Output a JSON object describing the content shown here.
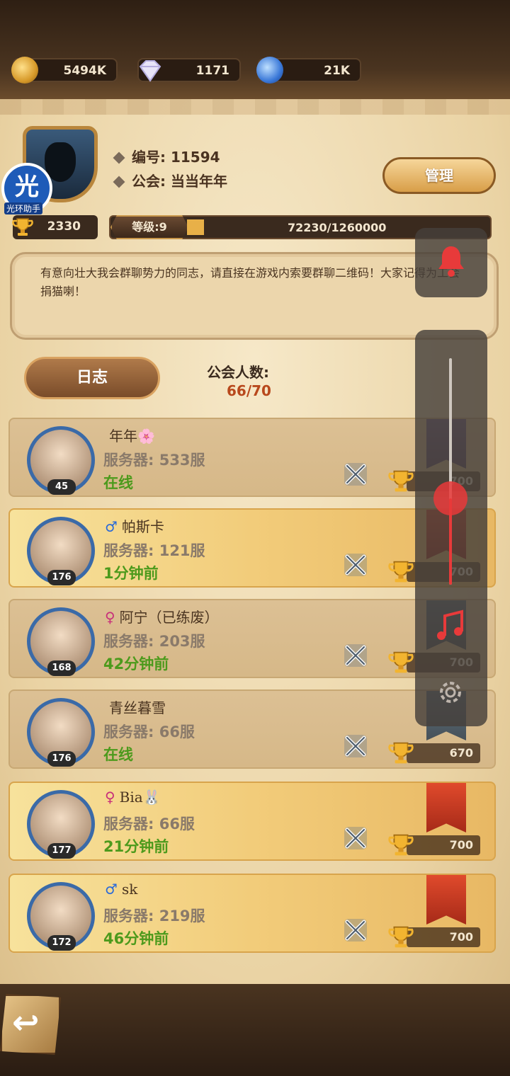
{
  "currencies": {
    "gold": {
      "value": "5494K",
      "icon": "gold-coin-icon"
    },
    "gems": {
      "value": "1171",
      "icon": "diamond-icon"
    },
    "scroll": {
      "value": "21K",
      "icon": "scroll-icon"
    }
  },
  "guild": {
    "id_label": "编号: 11594",
    "name_label": "公会: 当当年年",
    "manage_label": "管理",
    "trophies": "2330",
    "level_label": "等级:9",
    "exp_text": "72230/1260000",
    "exp_fraction": 0.0573,
    "notice": "有意向壮大我会群聊势力的同志，请直接在游戏内索要群聊二维码！大家记得为工会捐猫喇！",
    "log_label": "日志",
    "member_count_label": "公会人数:",
    "member_count": "66/70"
  },
  "helper": {
    "glyph": "光",
    "label": "光环助手"
  },
  "members": [
    {
      "name": "年年🌸",
      "sex": "",
      "sex_glyph": "",
      "server": "服务器: 533服",
      "status": "在线",
      "level": "45",
      "trophies": "700",
      "style": "plain",
      "banner": "purple"
    },
    {
      "name": "帕斯卡",
      "sex": "male",
      "sex_glyph": "♂",
      "server": "服务器: 121服",
      "status": "1分钟前",
      "level": "176",
      "trophies": "700",
      "style": "gold",
      "banner": "red"
    },
    {
      "name": "阿宁（已练废）",
      "sex": "female",
      "sex_glyph": "♀",
      "server": "服务器: 203服",
      "status": "42分钟前",
      "level": "168",
      "trophies": "700",
      "style": "plain",
      "banner": "blue"
    },
    {
      "name": "青丝暮雪",
      "sex": "",
      "sex_glyph": "",
      "server": "服务器: 66服",
      "status": "在线",
      "level": "176",
      "trophies": "670",
      "style": "plain",
      "banner": "blue"
    },
    {
      "name": "Bia🐰",
      "sex": "female",
      "sex_glyph": "♀",
      "server": "服务器: 66服",
      "status": "21分钟前",
      "level": "177",
      "trophies": "700",
      "style": "gold",
      "banner": "red"
    },
    {
      "name": "sk",
      "sex": "male",
      "sex_glyph": "♂",
      "server": "服务器: 219服",
      "status": "46分钟前",
      "level": "172",
      "trophies": "700",
      "style": "gold",
      "banner": "red"
    }
  ],
  "overlay": {
    "bell_icon": "bell-icon",
    "music_icon": "music-note-icon",
    "settings_icon": "gear-icon",
    "volume_level": 0.62
  },
  "colors": {
    "accent_red": "#e83a3a",
    "online_green": "#4c9a1c",
    "count_red": "#b8481c"
  }
}
